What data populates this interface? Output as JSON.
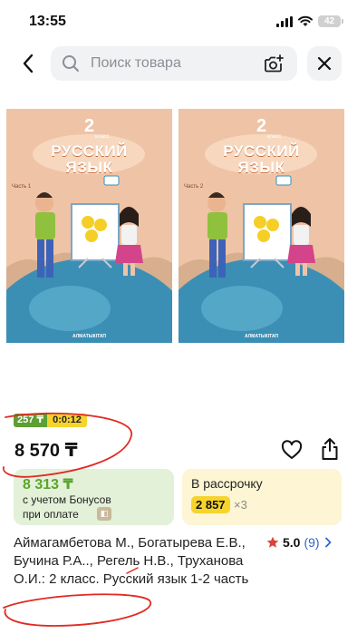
{
  "status_bar": {
    "time": "13:55",
    "battery": "42"
  },
  "search": {
    "placeholder": "Поиск товара"
  },
  "gallery": {
    "books": [
      {
        "grade": "2",
        "grade_word": "класс",
        "title_line1": "РУССКИЙ",
        "title_line2": "ЯЗЫК",
        "part": "Часть 1",
        "publisher": "АЛМАТЫКІТАП"
      },
      {
        "grade": "2",
        "grade_word": "класс",
        "title_line1": "РУССКИЙ",
        "title_line2": "ЯЗЫК",
        "part": "Часть 2",
        "publisher": "АЛМАТЫКІТАП"
      }
    ]
  },
  "badges": {
    "cashback": "257 ₸",
    "timer": "0:0:12"
  },
  "price": "8 570 ₸",
  "bonus_card": {
    "amount": "8 313 ₸",
    "line1": "с учетом Бонусов",
    "line2": "при оплате"
  },
  "installment_card": {
    "title": "В рассрочку",
    "monthly": "2 857",
    "multiplier": "×3"
  },
  "product": {
    "title": "Аймагамбетова М., Богатырева Е.В., Бучина Р.А.., Регель Н.В., Труханова О.И.: 2 класс. Русский язык 1-2 часть",
    "rating": "5.0",
    "reviews": "(9)"
  },
  "colors": {
    "green": "#5aa52c",
    "yellow": "#f6d42e",
    "annotation_red": "#e02a22",
    "link_blue": "#2f63c9"
  }
}
